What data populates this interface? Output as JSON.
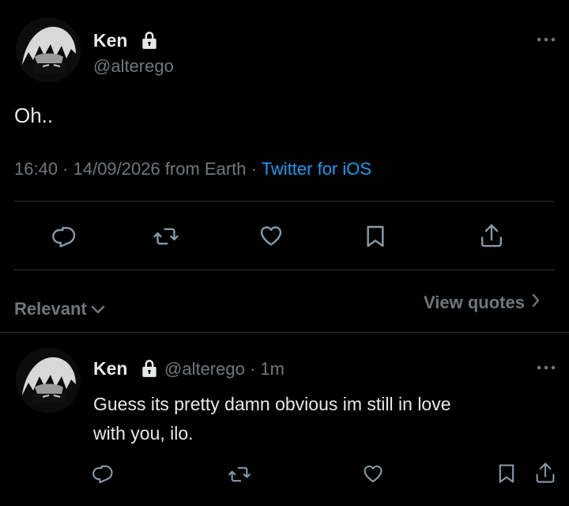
{
  "tweet": {
    "author_name": "Ken",
    "handle": "@alterego",
    "text": "Oh..",
    "meta_text": "16:40 · 14/09/2026 from Earth · ",
    "source": "Twitter for iOS"
  },
  "controls": {
    "sort_label": "Relevant",
    "view_quotes": "View quotes"
  },
  "reply": {
    "author_name": "Ken",
    "handle_time": "@alterego · 1m",
    "text_line1": "Guess its pretty damn obvious im still in love",
    "text_line2": "with you, ilo."
  },
  "colors": {
    "background": "#000000",
    "text": "#e7e9ea",
    "muted": "#71767b",
    "accent": "#1d9bf0",
    "divider": "#2f3336"
  },
  "icons": [
    "more-icon",
    "lock-icon",
    "reply-icon",
    "retweet-icon",
    "like-icon",
    "bookmark-icon",
    "share-icon",
    "chevron-down-icon",
    "chevron-right-icon"
  ]
}
